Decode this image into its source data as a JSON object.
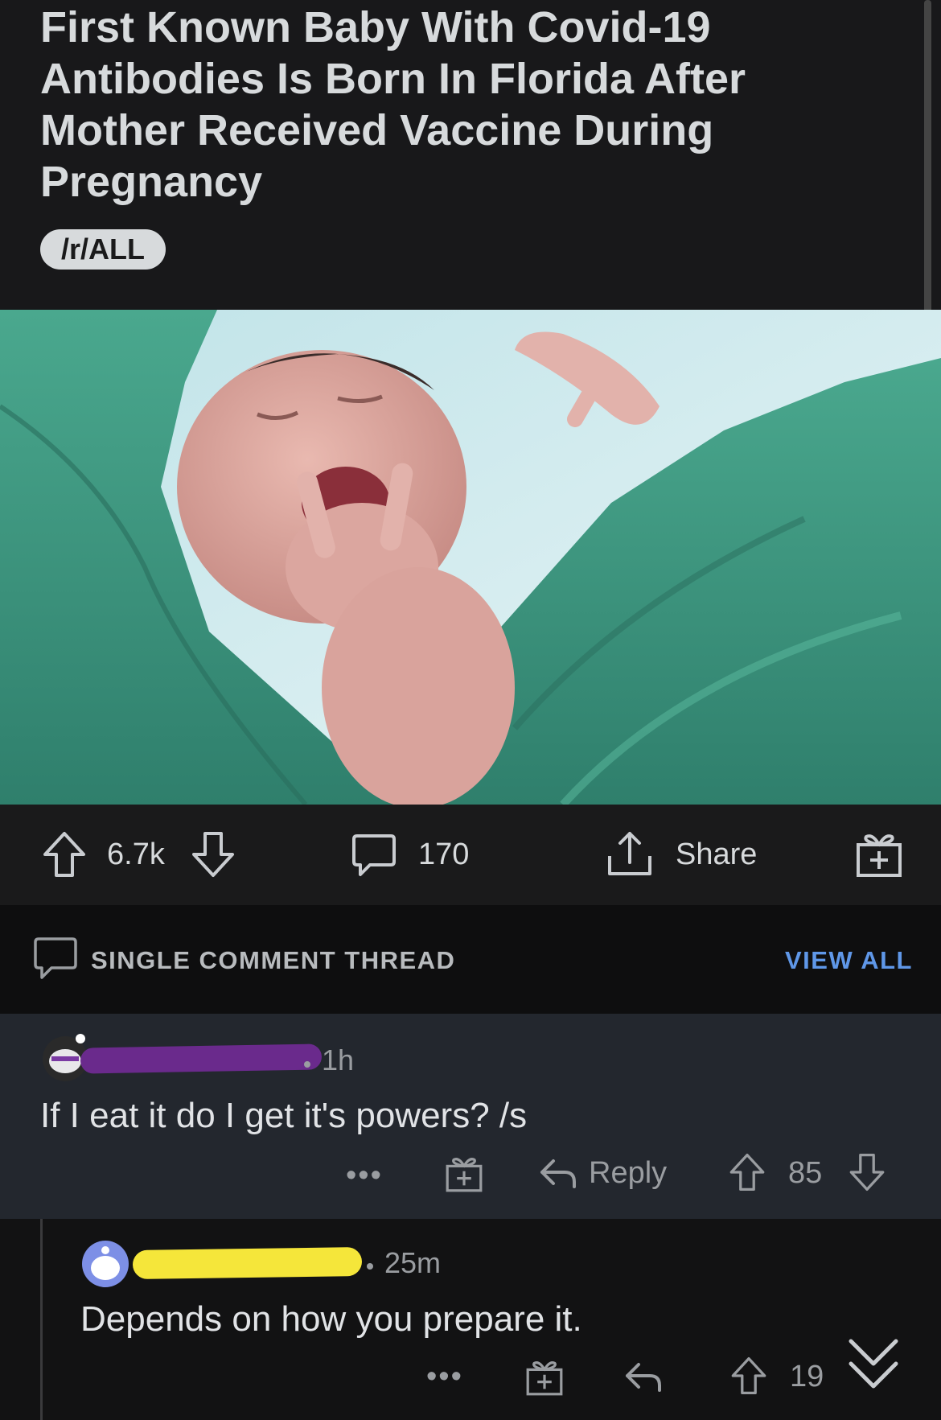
{
  "post": {
    "title": "First Known Baby With Covid-19 Antibodies Is Born In Florida After Mother Received Vaccine During Pregnancy",
    "subreddit": "/r/ALL",
    "upvotes": "6.7k",
    "comments": "170",
    "share_label": "Share"
  },
  "thread": {
    "label": "SINGLE COMMENT THREAD",
    "view_all": "VIEW ALL"
  },
  "comments": [
    {
      "time": "1h",
      "text": "If I eat it do I get it's powers? /s",
      "reply_label": "Reply",
      "score": "85"
    },
    {
      "time": "25m",
      "text": "Depends on how you prepare it.",
      "score": "19"
    }
  ],
  "colors": {
    "accent": "#5f97e8",
    "redaction_purple": "#6a2a8c",
    "redaction_yellow": "#f5e63a",
    "scrubs_green": "#3f9a82"
  }
}
